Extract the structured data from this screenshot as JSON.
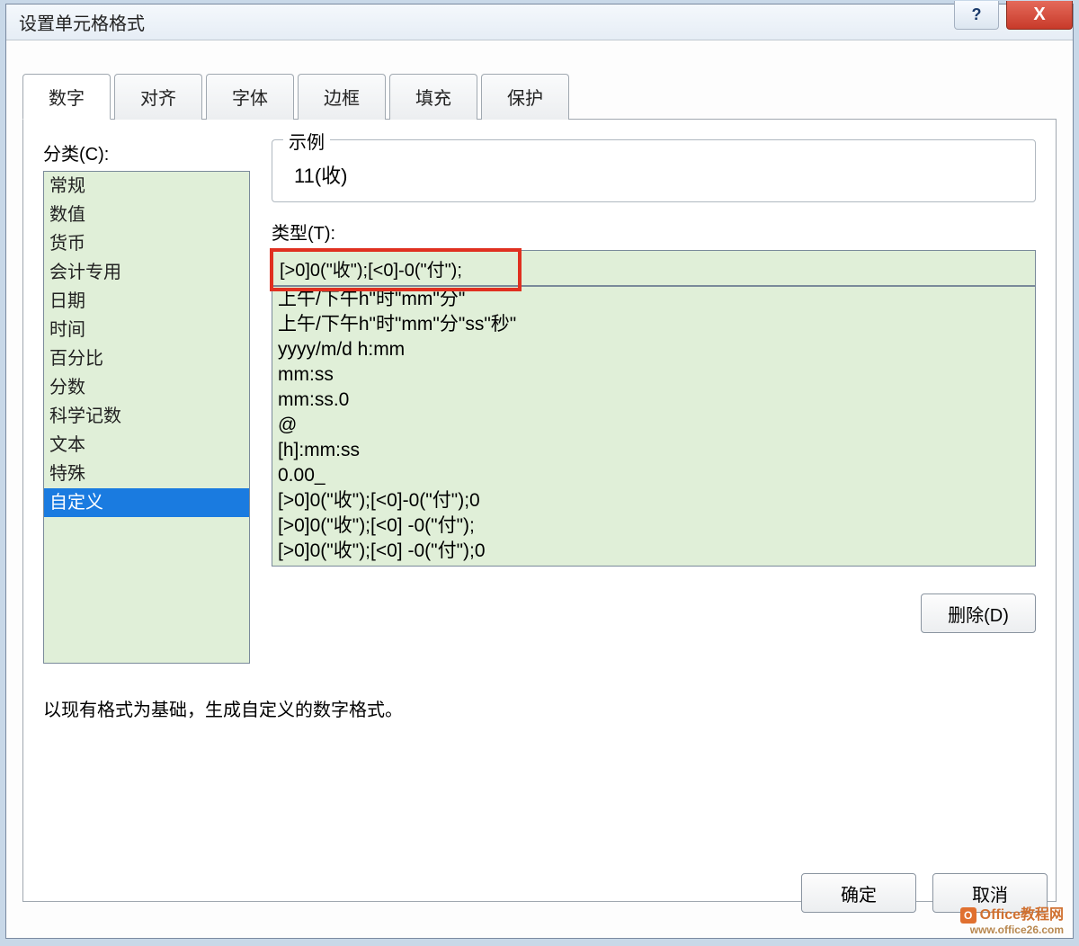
{
  "title": "设置单元格格式",
  "titlebar": {
    "help_label": "?",
    "close_label": "X"
  },
  "tabs": [
    "数字",
    "对齐",
    "字体",
    "边框",
    "填充",
    "保护"
  ],
  "active_tab_index": 0,
  "category_label": "分类(C):",
  "categories": [
    "常规",
    "数值",
    "货币",
    "会计专用",
    "日期",
    "时间",
    "百分比",
    "分数",
    "科学记数",
    "文本",
    "特殊",
    "自定义"
  ],
  "selected_category_index": 11,
  "sample": {
    "legend": "示例",
    "value": "11(收)"
  },
  "type_label": "类型(T):",
  "type_value": "[>0]0(\"收\");[<0]-0(\"付\");",
  "type_options": [
    "上午/下午h\"时\"mm\"分\"",
    "上午/下午h\"时\"mm\"分\"ss\"秒\"",
    "yyyy/m/d h:mm",
    "mm:ss",
    "mm:ss.0",
    "@",
    "[h]:mm:ss",
    "0.00_",
    "[>0]0(\"收\");[<0]-0(\"付\");0",
    "[>0]0(\"收\");[<0] -0(\"付\");",
    "[>0]0(\"收\");[<0] -0(\"付\");0"
  ],
  "delete_label": "删除(D)",
  "hint": "以现有格式为基础，生成自定义的数字格式。",
  "ok_label": "确定",
  "cancel_label": "取消",
  "watermark": {
    "main": "Office教程网",
    "sub": "www.office26.com"
  }
}
